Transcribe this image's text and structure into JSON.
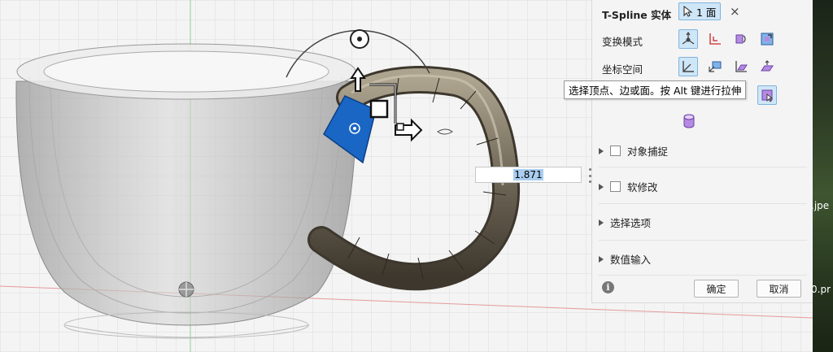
{
  "panel": {
    "title": "T-Spline 实体",
    "selection_label": "1 面",
    "close_glyph": "×",
    "transform_mode_label": "变换模式",
    "coord_space_label": "坐标空间",
    "sections": [
      {
        "label": "对象捕捉",
        "checkbox": true
      },
      {
        "label": "软修改",
        "checkbox": true
      },
      {
        "label": "选择选项",
        "checkbox": false
      },
      {
        "label": "数值输入",
        "checkbox": false
      }
    ],
    "ok_label": "确定",
    "cancel_label": "取消",
    "info_glyph": "i"
  },
  "tooltip": "选择顶点、边或面。按 Alt 键进行拉伸",
  "value_input": "1.871",
  "background_strip": {
    "text1": ".jpe",
    "text2": "0.pr"
  },
  "icons": [
    "cursor-icon",
    "close-icon",
    "multi-transform-icon",
    "translate-icon",
    "rotate-icon",
    "scale-icon",
    "world-space-icon",
    "view-space-icon",
    "local-space-icon",
    "parallel-space-icon",
    "selection-filter-icon",
    "cylinder-icon",
    "info-icon",
    "axis-triad-icon"
  ],
  "colors": {
    "accent": "#1a66c4",
    "active_button": "#cfe6f7",
    "panel_bg": "#f4f4f4"
  }
}
